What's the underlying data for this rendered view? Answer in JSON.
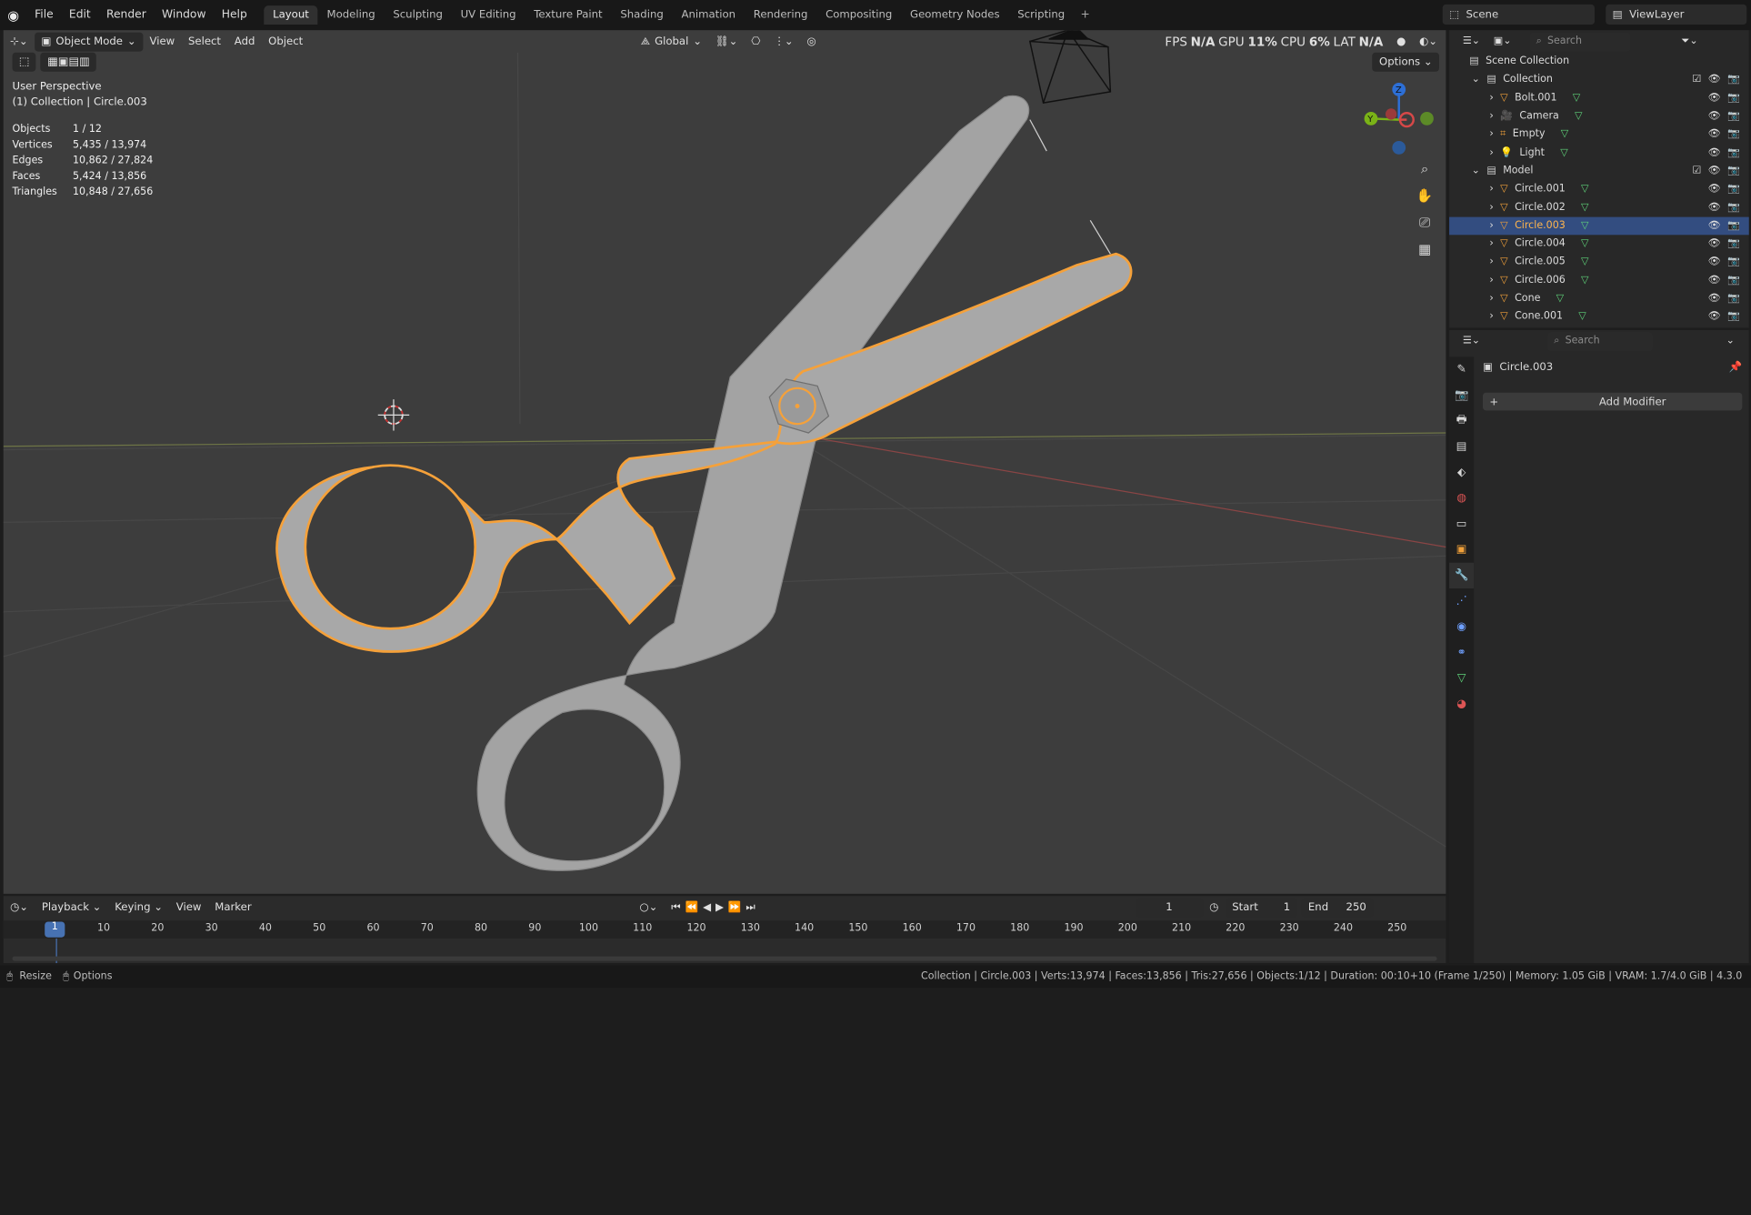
{
  "menubar": {
    "items": [
      "File",
      "Edit",
      "Render",
      "Window",
      "Help"
    ],
    "workspaces": [
      "Layout",
      "Modeling",
      "Sculpting",
      "UV Editing",
      "Texture Paint",
      "Shading",
      "Animation",
      "Rendering",
      "Compositing",
      "Geometry Nodes",
      "Scripting"
    ],
    "active_workspace": "Layout",
    "plus": "+",
    "scene": "Scene",
    "view_layer": "ViewLayer"
  },
  "viewport": {
    "mode": "Object Mode",
    "menus": [
      "View",
      "Select",
      "Add",
      "Object"
    ],
    "transform_orientation": "Global",
    "options": "Options",
    "perf": {
      "fps_label": "FPS",
      "fps": "N/A",
      "gpu_label": "GPU",
      "gpu": "11%",
      "cpu_label": "CPU",
      "cpu": "6%",
      "lat_label": "LAT",
      "lat": "N/A"
    },
    "view_name": "User Perspective",
    "collection_info": "(1) Collection | Circle.003",
    "stats": [
      {
        "label": "Objects",
        "value": "1 / 12"
      },
      {
        "label": "Vertices",
        "value": "5,435 / 13,974"
      },
      {
        "label": "Edges",
        "value": "10,862 / 27,824"
      },
      {
        "label": "Faces",
        "value": "5,424 / 13,856"
      },
      {
        "label": "Triangles",
        "value": "10,848 / 27,656"
      }
    ],
    "gizmo": {
      "x": "X",
      "y": "Y",
      "z": "Z"
    }
  },
  "outliner": {
    "search_placeholder": "Search",
    "root": "Scene Collection",
    "rows": [
      {
        "name": "Collection",
        "type": "collection",
        "depth": 1
      },
      {
        "name": "Bolt.001",
        "type": "mesh",
        "depth": 2
      },
      {
        "name": "Camera",
        "type": "camera",
        "depth": 2
      },
      {
        "name": "Empty",
        "type": "empty",
        "depth": 2
      },
      {
        "name": "Light",
        "type": "light",
        "depth": 2
      },
      {
        "name": "Model",
        "type": "collection",
        "depth": 1
      },
      {
        "name": "Circle.001",
        "type": "mesh",
        "depth": 2
      },
      {
        "name": "Circle.002",
        "type": "mesh",
        "depth": 2
      },
      {
        "name": "Circle.003",
        "type": "mesh",
        "depth": 2,
        "selected": true
      },
      {
        "name": "Circle.004",
        "type": "mesh",
        "depth": 2
      },
      {
        "name": "Circle.005",
        "type": "mesh",
        "depth": 2
      },
      {
        "name": "Circle.006",
        "type": "mesh",
        "depth": 2
      },
      {
        "name": "Cone",
        "type": "mesh",
        "depth": 2
      },
      {
        "name": "Cone.001",
        "type": "mesh",
        "depth": 2
      }
    ]
  },
  "properties": {
    "search_placeholder": "Search",
    "object_name": "Circle.003",
    "add_modifier": "Add Modifier"
  },
  "timeline": {
    "menus": [
      "Playback",
      "Keying",
      "View",
      "Marker"
    ],
    "current_frame": "1",
    "start_label": "Start",
    "start": "1",
    "end_label": "End",
    "end": "250",
    "ticks": [
      "10",
      "20",
      "30",
      "40",
      "50",
      "60",
      "70",
      "80",
      "90",
      "100",
      "110",
      "120",
      "130",
      "140",
      "150",
      "160",
      "170",
      "180",
      "190",
      "200",
      "210",
      "220",
      "230",
      "240",
      "250"
    ],
    "playhead": "1"
  },
  "statusbar": {
    "left_resize": "Resize",
    "left_options": "Options",
    "info": "Collection | Circle.003 | Verts:13,974 | Faces:13,856 | Tris:27,656 | Objects:1/12 | Duration: 00:10+10 (Frame 1/250) | Memory: 1.05 GiB | VRAM: 1.7/4.0 GiB | 4.3.0"
  },
  "colors": {
    "accent": "#f5a13a",
    "selection": "#334d80",
    "viewport_bg": "#3d3d3d",
    "playhead": "#4772b3"
  }
}
